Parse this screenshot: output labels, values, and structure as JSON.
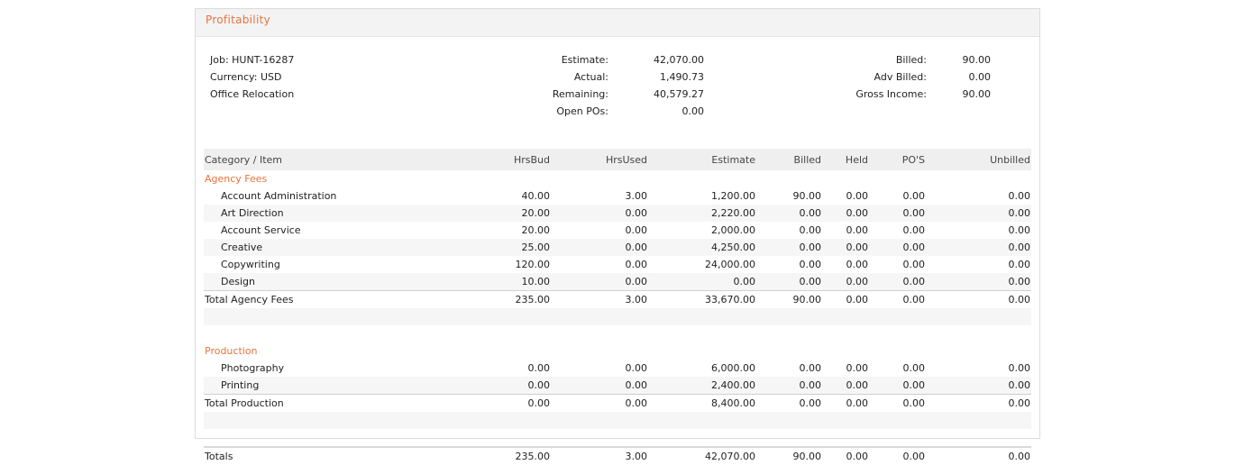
{
  "panel": {
    "title": "Profitability"
  },
  "job": {
    "job_line": "Job: HUNT-16287",
    "currency_line": "Currency: USD",
    "description": "Office Relocation"
  },
  "summary_mid": [
    {
      "label": "Estimate:",
      "value": "42,070.00"
    },
    {
      "label": "Actual:",
      "value": "1,490.73"
    },
    {
      "label": "Remaining:",
      "value": "40,579.27"
    },
    {
      "label": "Open POs:",
      "value": "0.00"
    }
  ],
  "summary_right": [
    {
      "label": "Billed:",
      "value": "90.00"
    },
    {
      "label": "Adv Billed:",
      "value": "0.00"
    },
    {
      "label": "Gross Income:",
      "value": "90.00"
    }
  ],
  "table": {
    "columns": [
      "Category / Item",
      "HrsBud",
      "HrsUsed",
      "Estimate",
      "Billed",
      "Held",
      "PO'S",
      "Unbilled"
    ],
    "sections": [
      {
        "name": "Agency Fees",
        "items": [
          [
            "Account Administration",
            "40.00",
            "3.00",
            "1,200.00",
            "90.00",
            "0.00",
            "0.00",
            "0.00"
          ],
          [
            "Art Direction",
            "20.00",
            "0.00",
            "2,220.00",
            "0.00",
            "0.00",
            "0.00",
            "0.00"
          ],
          [
            "Account Service",
            "20.00",
            "0.00",
            "2,000.00",
            "0.00",
            "0.00",
            "0.00",
            "0.00"
          ],
          [
            "Creative",
            "25.00",
            "0.00",
            "4,250.00",
            "0.00",
            "0.00",
            "0.00",
            "0.00"
          ],
          [
            "Copywriting",
            "120.00",
            "0.00",
            "24,000.00",
            "0.00",
            "0.00",
            "0.00",
            "0.00"
          ],
          [
            "Design",
            "10.00",
            "0.00",
            "0.00",
            "0.00",
            "0.00",
            "0.00",
            "0.00"
          ]
        ],
        "total": [
          "Total Agency Fees",
          "235.00",
          "3.00",
          "33,670.00",
          "90.00",
          "0.00",
          "0.00",
          "0.00"
        ]
      },
      {
        "name": "Production",
        "items": [
          [
            "Photography",
            "0.00",
            "0.00",
            "6,000.00",
            "0.00",
            "0.00",
            "0.00",
            "0.00"
          ],
          [
            "Printing",
            "0.00",
            "0.00",
            "2,400.00",
            "0.00",
            "0.00",
            "0.00",
            "0.00"
          ]
        ],
        "total": [
          "Total Production",
          "0.00",
          "0.00",
          "8,400.00",
          "0.00",
          "0.00",
          "0.00",
          "0.00"
        ]
      }
    ],
    "grand_total": [
      "Totals",
      "235.00",
      "3.00",
      "42,070.00",
      "90.00",
      "0.00",
      "0.00",
      "0.00"
    ]
  }
}
